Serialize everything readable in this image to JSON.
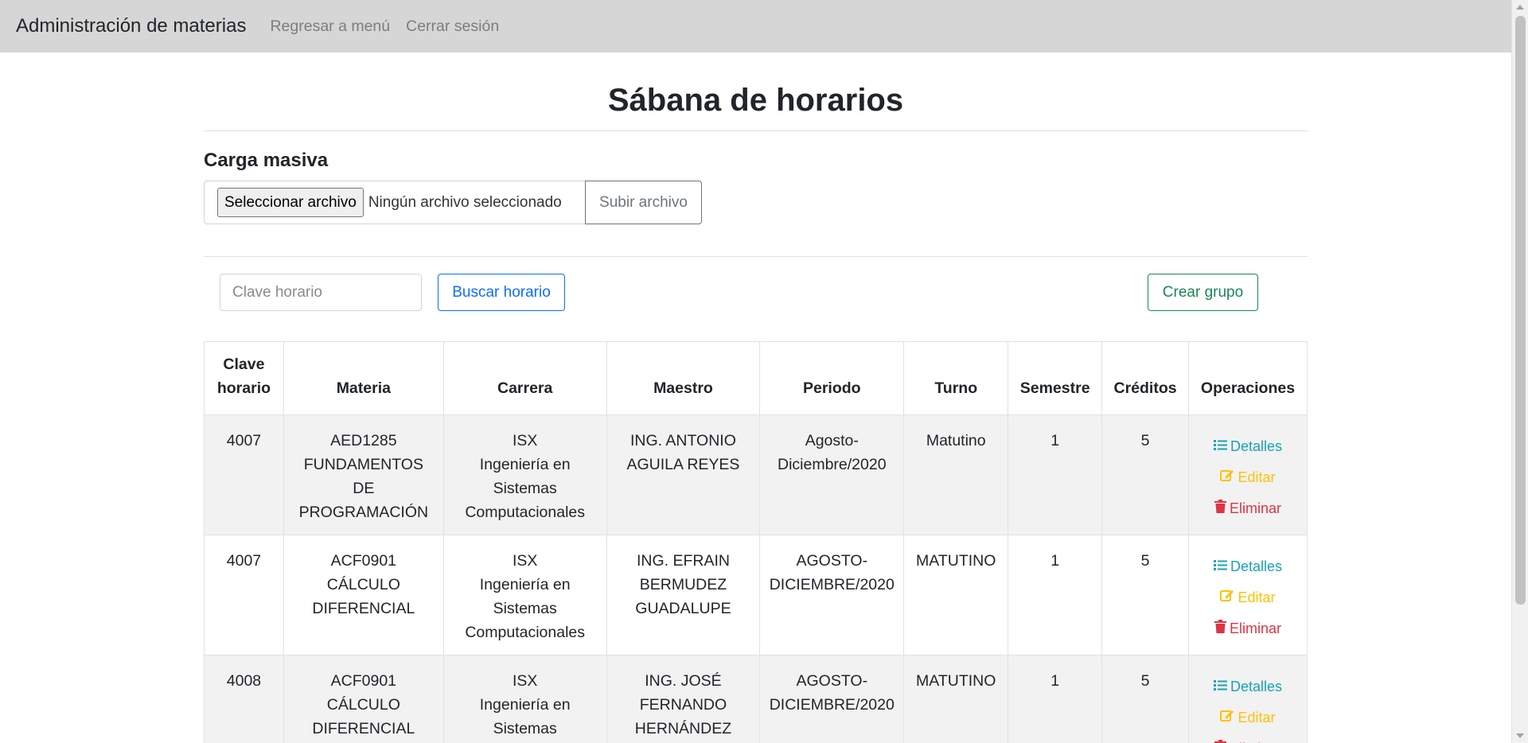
{
  "navbar": {
    "brand": "Administración de materias",
    "links": [
      "Regresar a menú",
      "Cerrar sesión"
    ]
  },
  "page": {
    "title": "Sábana de horarios"
  },
  "upload": {
    "section_title": "Carga masiva",
    "file_button": "Seleccionar archivo",
    "file_status": "Ningún archivo seleccionado",
    "submit_button": "Subir archivo"
  },
  "search": {
    "placeholder": "Clave horario",
    "search_button": "Buscar horario",
    "create_button": "Crear grupo"
  },
  "table": {
    "headers": [
      "Clave horario",
      "Materia",
      "Carrera",
      "Maestro",
      "Periodo",
      "Turno",
      "Semestre",
      "Créditos",
      "Operaciones"
    ],
    "rows": [
      {
        "clave": "4007",
        "materia": [
          "AED1285",
          "FUNDAMENTOS",
          "DE",
          "PROGRAMACIÓN"
        ],
        "carrera": [
          "ISX",
          "Ingeniería en",
          "Sistemas",
          "Computacionales"
        ],
        "maestro": [
          "ING. ANTONIO",
          "AGUILA REYES"
        ],
        "periodo": [
          "Agosto-",
          "Diciembre/2020"
        ],
        "turno": "Matutino",
        "semestre": "1",
        "creditos": "5"
      },
      {
        "clave": "4007",
        "materia": [
          "ACF0901",
          "CÁLCULO",
          "DIFERENCIAL"
        ],
        "carrera": [
          "ISX",
          "Ingeniería en",
          "Sistemas",
          "Computacionales"
        ],
        "maestro": [
          "ING. EFRAIN",
          "BERMUDEZ",
          "GUADALUPE"
        ],
        "periodo": [
          "AGOSTO-",
          "DICIEMBRE/2020"
        ],
        "turno": "MATUTINO",
        "semestre": "1",
        "creditos": "5"
      },
      {
        "clave": "4008",
        "materia": [
          "ACF0901",
          "CÁLCULO",
          "DIFERENCIAL"
        ],
        "carrera": [
          "ISX",
          "Ingeniería en",
          "Sistemas"
        ],
        "maestro": [
          "ING. JOSÉ",
          "FERNANDO",
          "HERNÁNDEZ"
        ],
        "periodo": [
          "AGOSTO-",
          "DICIEMBRE/2020"
        ],
        "turno": "MATUTINO",
        "semestre": "1",
        "creditos": "5"
      }
    ],
    "operations": {
      "details": "Detalles",
      "edit": "Editar",
      "delete": "Eliminar"
    }
  },
  "colors": {
    "navbar_bg": "#d6d6d6",
    "primary": "#0d6efd",
    "success": "#198754",
    "info": "#17a2b8",
    "warning": "#ffc107",
    "danger": "#dc3545"
  }
}
